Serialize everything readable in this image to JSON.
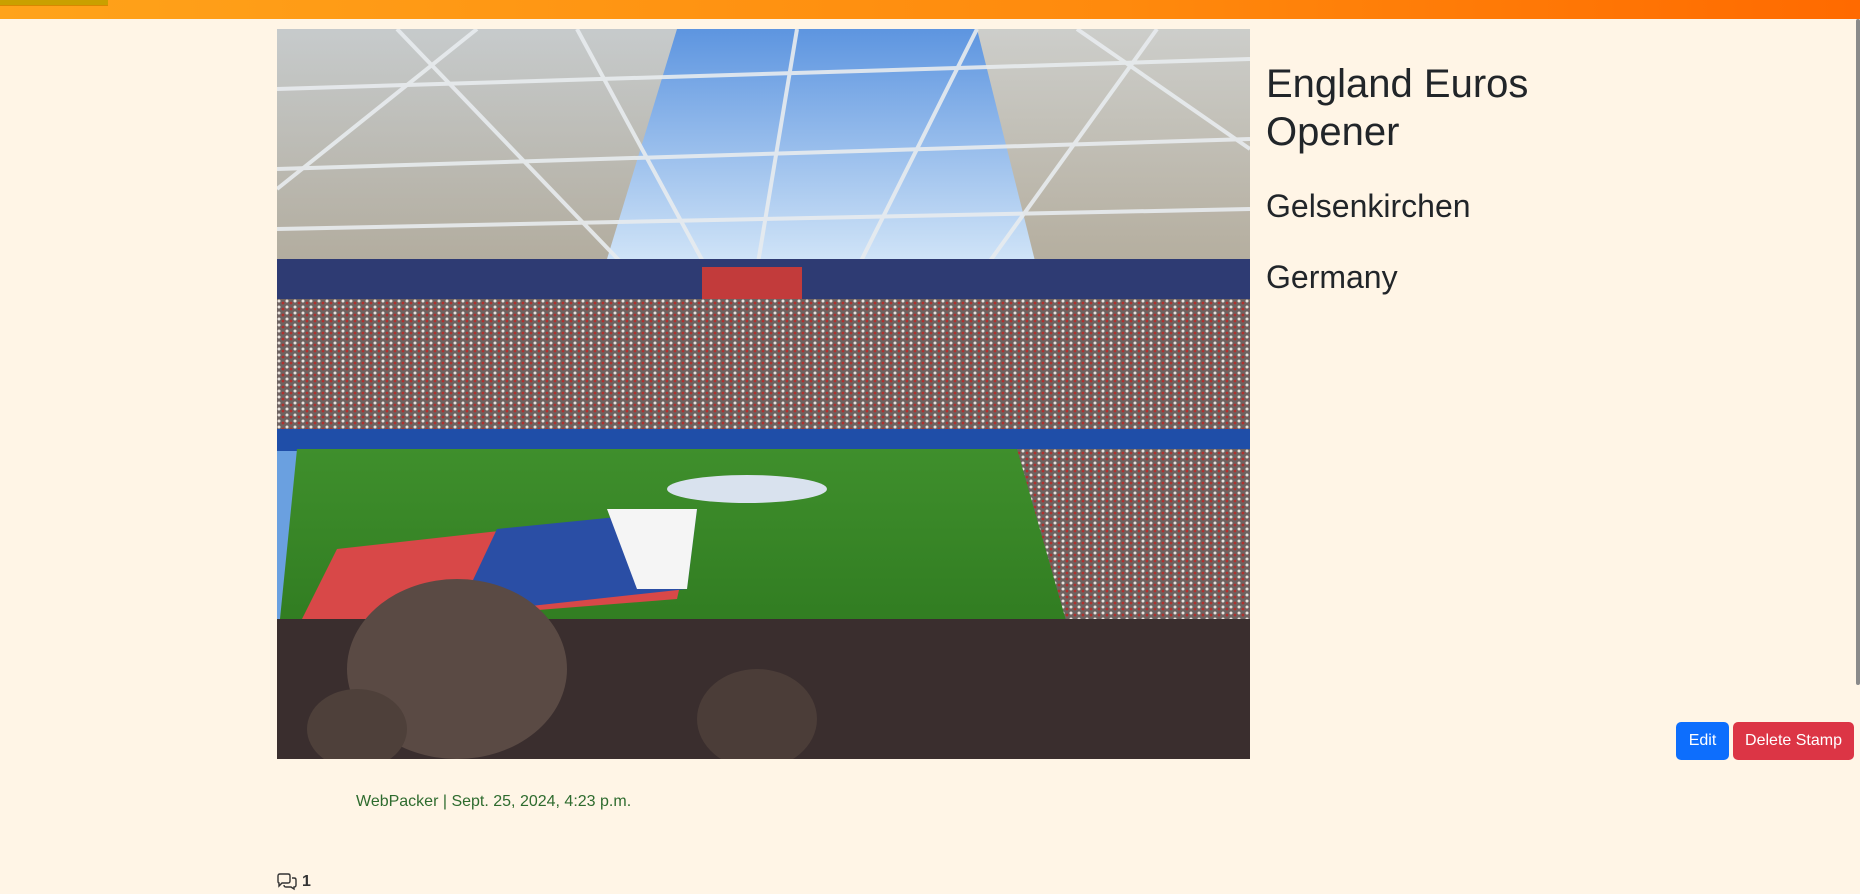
{
  "header": {
    "accent": "#ff8a0d"
  },
  "stamp": {
    "image_alt": "Stadium photo",
    "title": "England Euros Opener",
    "city": "Gelsenkirchen",
    "country": "Germany"
  },
  "actions": {
    "edit_label": "Edit",
    "delete_label": "Delete Stamp",
    "edit_color": "#0d6efd",
    "delete_color": "#dc3545"
  },
  "meta": {
    "author": "WebPacker",
    "separator": " | ",
    "date": "Sept. 25, 2024, 4:23 p.m."
  },
  "comments": {
    "icon": "comments-icon",
    "count": "1"
  }
}
